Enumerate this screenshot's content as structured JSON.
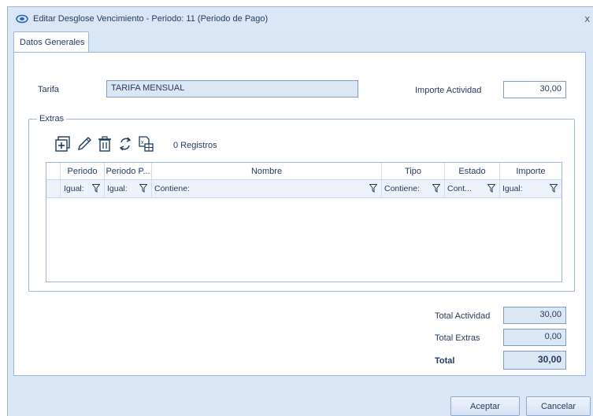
{
  "window": {
    "title": "Editar Desglose Vencimiento - Periodo: 11 (Periodo de Pago)",
    "close_label": "x"
  },
  "tabs": [
    {
      "label": "Datos Generales"
    }
  ],
  "general": {
    "tarifa_label": "Tarifa",
    "tarifa_value": "TARIFA MENSUAL",
    "importe_actividad_label": "Importe Actividad",
    "importe_actividad_value": "30,00"
  },
  "extras": {
    "group_label": "Extras",
    "record_count": "0 Registros",
    "toolbar_icons": [
      "add-icon",
      "edit-icon",
      "delete-icon",
      "refresh-icon",
      "export-excel-icon"
    ],
    "columns": [
      "Periodo",
      "Periodo P...",
      "Nombre",
      "Tipo",
      "Estado",
      "Importe"
    ],
    "filters": [
      "Igual:",
      "Igual:",
      "Contiene:",
      "Contiene:",
      "Cont...",
      "Igual:"
    ],
    "rows": []
  },
  "totals": {
    "actividad_label": "Total Actividad",
    "actividad_value": "30,00",
    "extras_label": "Total Extras",
    "extras_value": "0,00",
    "total_label": "Total",
    "total_value": "30,00"
  },
  "buttons": {
    "accept": "Aceptar",
    "cancel": "Cancelar"
  },
  "colors": {
    "chrome": "#d9e6f6",
    "border": "#9db5d6",
    "text": "#1e395b",
    "readonly_field": "#dce7f5"
  }
}
